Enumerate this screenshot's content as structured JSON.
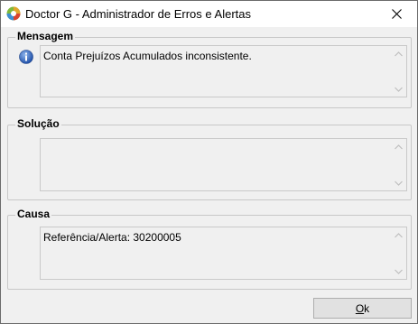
{
  "window": {
    "title": "Doctor G - Administrador de Erros e Alertas",
    "app_icon": "doctor-g-app-icon",
    "close_icon": "close-icon"
  },
  "groups": {
    "mensagem": {
      "title": "Mensagem",
      "icon": "info-icon",
      "text": "Conta Prejuízos Acumulados inconsistente."
    },
    "solucao": {
      "title": "Solução",
      "text": ""
    },
    "causa": {
      "title": "Causa",
      "text": "Referência/Alerta: 30200005"
    }
  },
  "buttons": {
    "ok_accel": "O",
    "ok_rest": "k"
  },
  "colors": {
    "window_bg": "#f0f0f0",
    "border": "#c8c8c8",
    "info_blue": "#2c5fb4"
  }
}
